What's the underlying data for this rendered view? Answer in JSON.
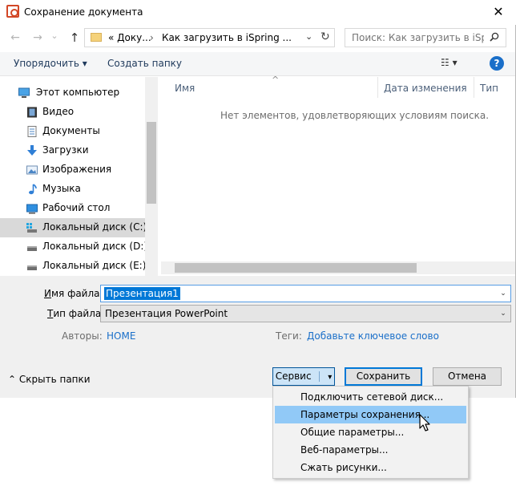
{
  "window": {
    "title": "Сохранение документа",
    "close_glyph": "✕"
  },
  "nav": {
    "back_glyph": "←",
    "forward_glyph": "→",
    "recent_glyph": "⌄",
    "up_glyph": "↑",
    "breadcrumbs": [
      "« Доку...",
      "Как загрузить в iSpring ..."
    ],
    "crumb_sep": "›",
    "crumb_dropdown_glyph": "⌄",
    "refresh_glyph": "↻",
    "search_placeholder": "Поиск: Как загрузить в iSprin..."
  },
  "toolbar": {
    "organize": "Упорядочить ▾",
    "new_folder": "Создать папку",
    "view_glyph": "☷ ▾",
    "help": "?"
  },
  "sidebar": {
    "items": [
      {
        "label": "Этот компьютер",
        "icon": "computer-icon"
      },
      {
        "label": "Видео",
        "icon": "video-icon"
      },
      {
        "label": "Документы",
        "icon": "documents-icon"
      },
      {
        "label": "Загрузки",
        "icon": "downloads-icon"
      },
      {
        "label": "Изображения",
        "icon": "pictures-icon"
      },
      {
        "label": "Музыка",
        "icon": "music-icon"
      },
      {
        "label": "Рабочий стол",
        "icon": "desktop-icon"
      },
      {
        "label": "Локальный диск (C:)",
        "icon": "drive-c-icon"
      },
      {
        "label": "Локальный диск (D:)",
        "icon": "drive-icon"
      },
      {
        "label": "Локальный диск (E:)",
        "icon": "drive-icon"
      }
    ],
    "selected_index": 7
  },
  "filelist": {
    "columns": [
      "Имя",
      "Дата изменения",
      "Тип"
    ],
    "sort_glyph": "^",
    "empty_message": "Нет элементов, удовлетворяющих условиям поиска."
  },
  "form": {
    "filename_label_ul": "И",
    "filename_label_rest": "мя файла:",
    "filename_value": "Презентация1",
    "filetype_label_ul": "Т",
    "filetype_label_rest": "ип файла:",
    "filetype_value": "Презентация PowerPoint",
    "combo_arrow_glyph": "⌄",
    "authors_label": "Авторы:",
    "authors_value": "HOME",
    "tags_label": "Теги:",
    "tags_value": "Добавьте ключевое слово"
  },
  "footer": {
    "hide_folders_glyph": "⌃",
    "hide_folders": "Скрыть папки",
    "service": "Сервис",
    "service_arrow": "▾",
    "save": "Сохранить",
    "cancel": "Отмена"
  },
  "menu": {
    "items": [
      "Подключить сетевой диск...",
      "Параметры сохранения...",
      "Общие параметры...",
      "Веб-параметры...",
      "Сжать рисунки..."
    ],
    "hover_index": 1
  },
  "colors": {
    "accent": "#0078d7",
    "link": "#1a6fc9",
    "menu_hover": "#91c9f7",
    "selected_nav": "#d9d9d9"
  }
}
